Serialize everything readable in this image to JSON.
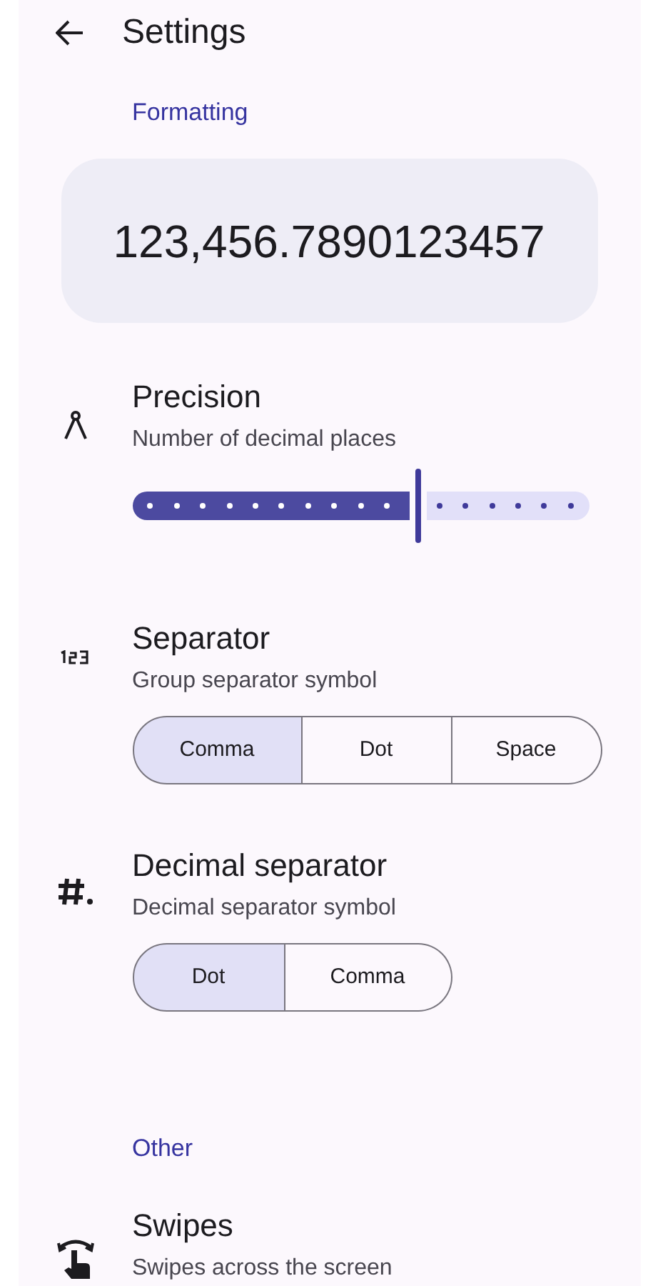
{
  "top_bar": {
    "title": "Settings"
  },
  "sections": [
    {
      "header": "Formatting",
      "preview": "123,456.7890123457",
      "items": [
        {
          "kind": "slider",
          "title": "Precision",
          "subtitle": "Number of decimal places",
          "level": 0.625
        },
        {
          "kind": "segmented",
          "title": "Separator",
          "subtitle": "Group separator symbol",
          "options": [
            {
              "label": "Comma",
              "selected": true
            },
            {
              "label": "Dot",
              "selected": false
            },
            {
              "label": "Space",
              "selected": false
            }
          ]
        },
        {
          "kind": "segmented",
          "title": "Decimal separator",
          "subtitle": "Decimal separator symbol",
          "options": [
            {
              "label": "Dot",
              "selected": true
            },
            {
              "label": "Comma",
              "selected": false
            }
          ]
        }
      ]
    },
    {
      "header": "Other",
      "items": [
        {
          "kind": "plain",
          "title": "Swipes",
          "subtitle": "Swipes across the screen"
        }
      ]
    }
  ]
}
